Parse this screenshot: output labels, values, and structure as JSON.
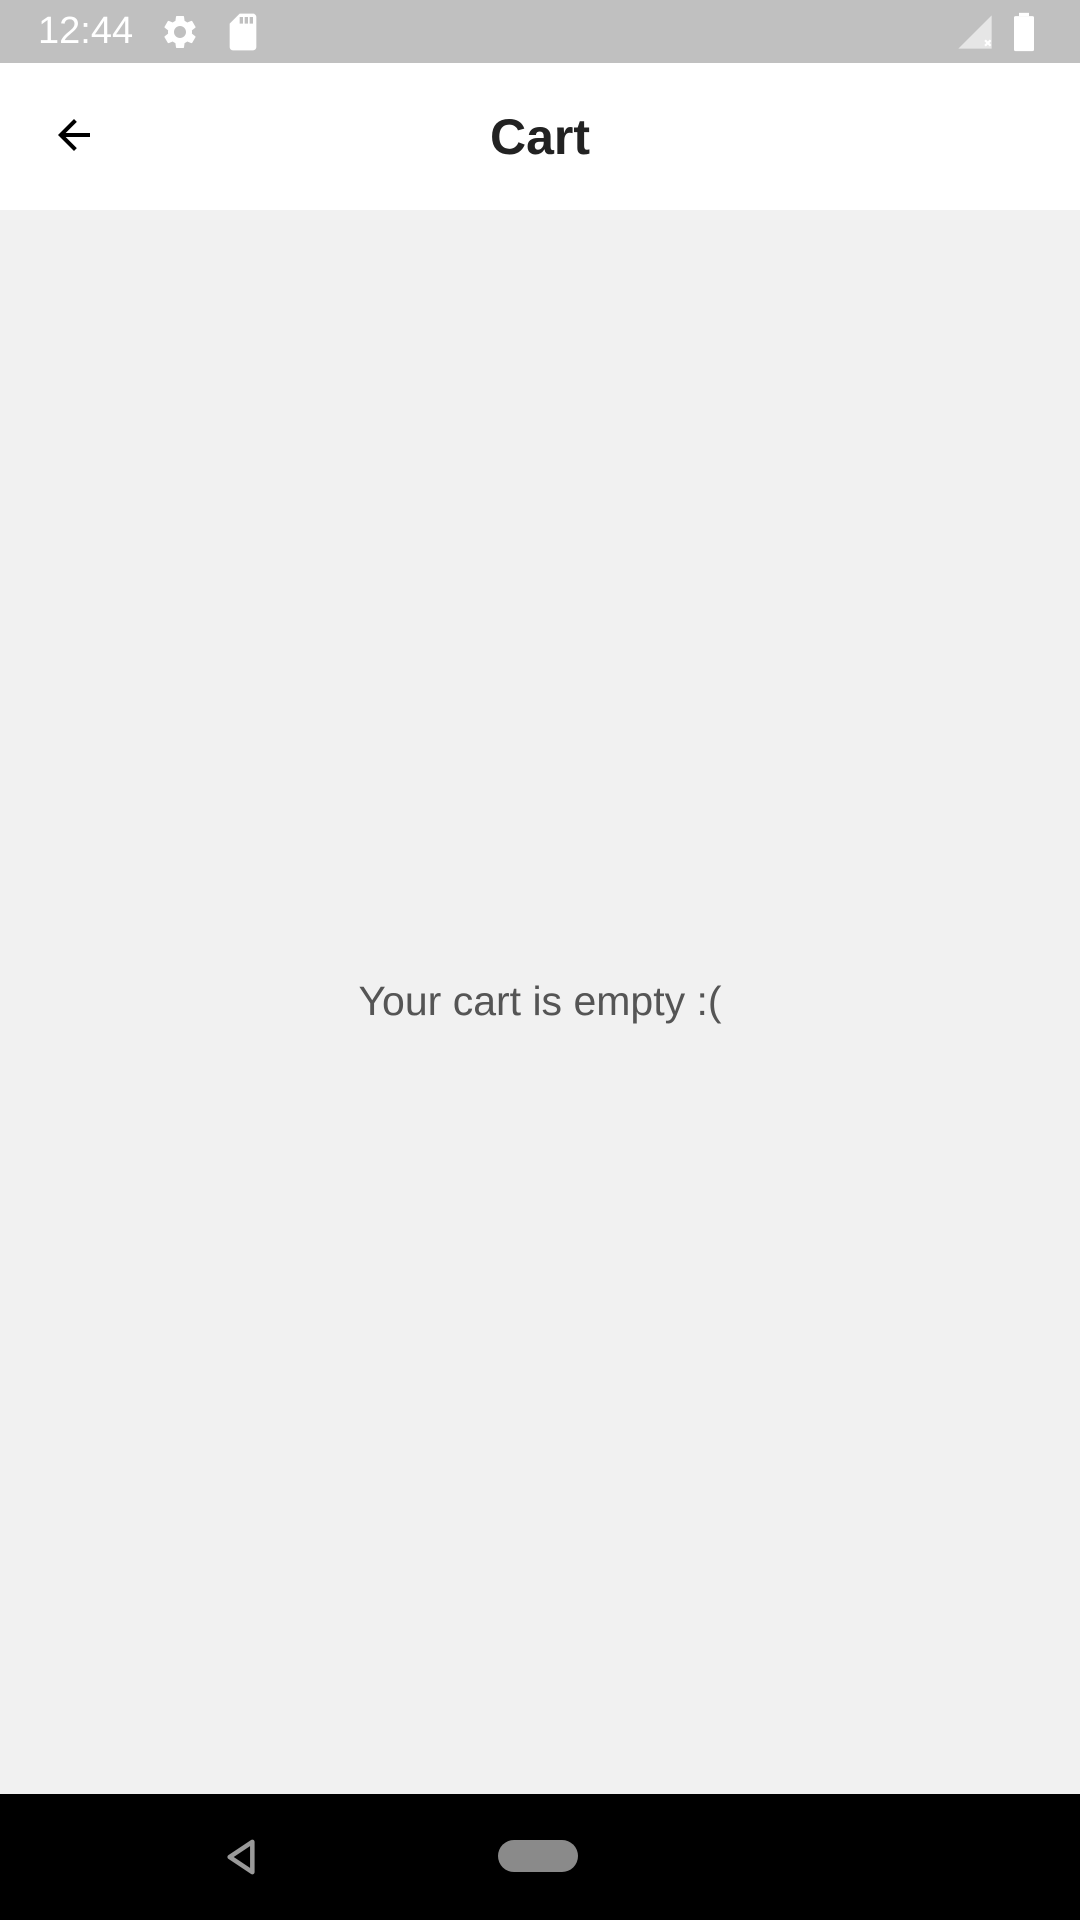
{
  "status_bar": {
    "time": "12:44",
    "icons": [
      "gear-icon",
      "sd-card-icon",
      "signal-off-icon",
      "battery-icon"
    ]
  },
  "app_bar": {
    "title": "Cart",
    "back_icon": "arrow-back-icon"
  },
  "content": {
    "empty_message": "Your cart is empty :("
  },
  "nav_bar": {
    "icons": [
      "nav-back-icon",
      "nav-home-pill"
    ]
  },
  "colors": {
    "status_bar_bg": "#c0c0c0",
    "app_bar_bg": "#ffffff",
    "content_bg": "#f1f1f1",
    "nav_bar_bg": "#000000",
    "title_text": "#222222",
    "message_text": "#555555"
  }
}
